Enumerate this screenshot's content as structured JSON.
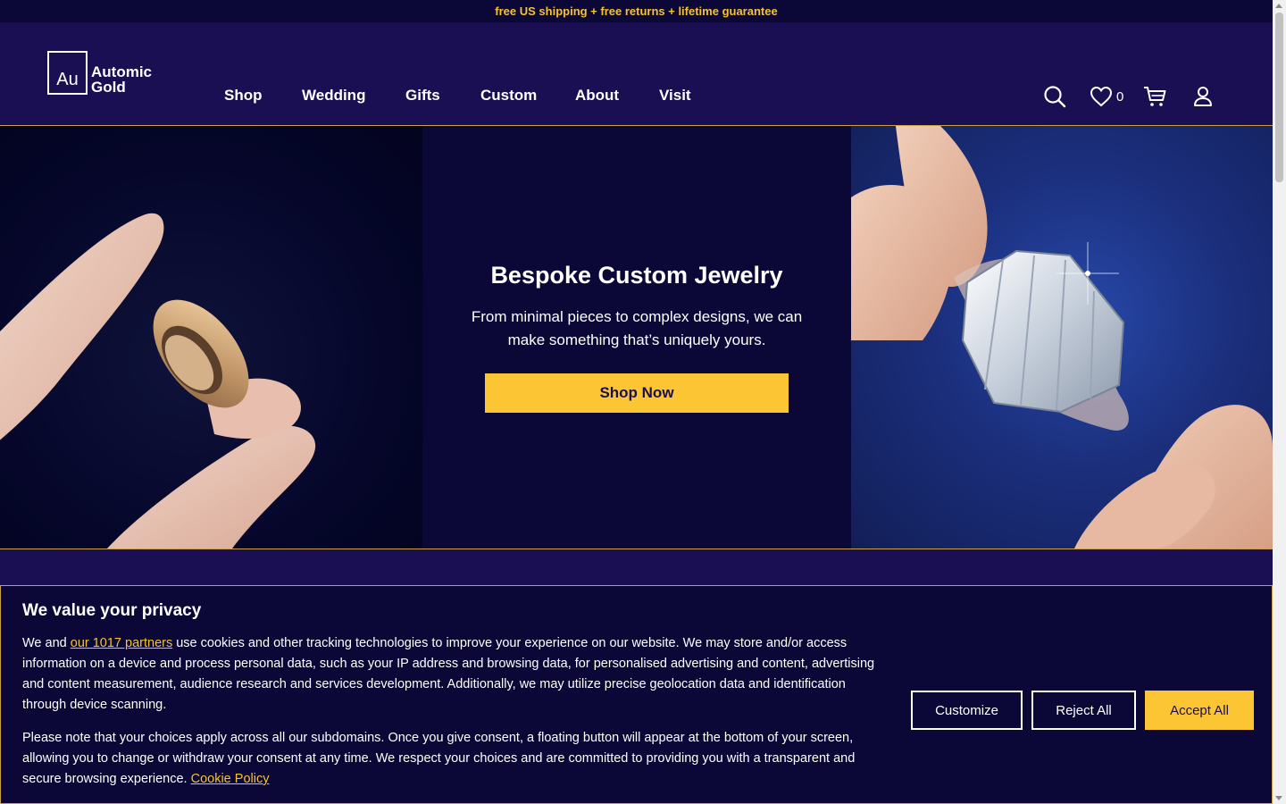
{
  "announcement": "free US shipping + free returns + lifetime guarantee",
  "logo": {
    "symbol": "Au",
    "line1": "Automic",
    "line2": "Gold"
  },
  "nav": [
    "Shop",
    "Wedding",
    "Gifts",
    "Custom",
    "About",
    "Visit"
  ],
  "header_icons": {
    "search": "search-icon",
    "wishlist": "heart-icon",
    "wishlist_count": "0",
    "cart": "cart-icon",
    "account": "user-icon"
  },
  "hero": {
    "title": "Bespoke Custom Jewelry",
    "subtitle": "From minimal pieces to complex designs, we can make something that’s uniquely yours.",
    "cta": "Shop Now"
  },
  "cookie": {
    "title": "We value your privacy",
    "p1_prefix": "We and ",
    "p1_link": "our 1017 partners",
    "p1_suffix": " use cookies and other tracking technologies to improve your experience on our website. We may store and/or access information on a device and process personal data, such as your IP address and browsing data, for personalised advertising and content, advertising and content measurement, audience research and services development. Additionally, we may utilize precise geolocation data and identification through device scanning.",
    "p2_text": "Please note that your choices apply across all our subdomains. Once you give consent, a floating button will appear at the bottom of your screen, allowing you to change or withdraw your consent at any time. We respect your choices and are committed to providing you with a transparent and secure browsing experience. ",
    "p2_link": "Cookie Policy",
    "buttons": {
      "customize": "Customize",
      "reject": "Reject All",
      "accept": "Accept All"
    }
  },
  "colors": {
    "navy": "#1a0f52",
    "dark": "#0b0838",
    "gold": "#fcc534",
    "accent_text": "#f6c231"
  }
}
